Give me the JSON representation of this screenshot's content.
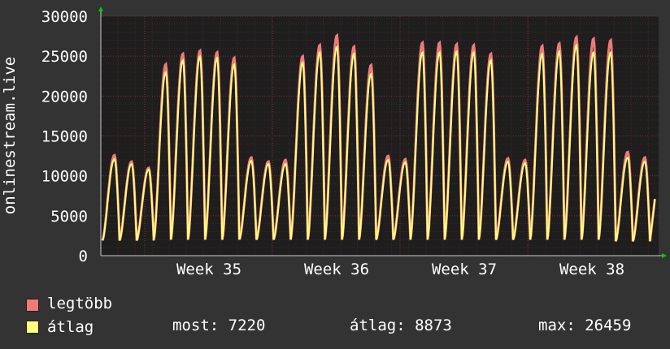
{
  "chart_data": {
    "type": "area",
    "ylabel": "onlinestream.live",
    "ylim": [
      0,
      30000
    ],
    "yticks": [
      0,
      5000,
      10000,
      15000,
      20000,
      25000,
      30000
    ],
    "ytick_labels": [
      "0",
      "5000",
      "10000",
      "15000",
      "20000",
      "25000",
      "30000"
    ],
    "xtick_labels": [
      "Week 35",
      "Week 36",
      "Week 37",
      "Week 38"
    ],
    "grid": true,
    "colors": {
      "background": "#333333",
      "plot": "#1e1e1e",
      "grid": "#6a2a2a",
      "legtobb": "#f07a7a",
      "atlag": "#ffff80",
      "axis_arrow": "#00cc00"
    },
    "days": [
      {
        "day": 1,
        "max": 12600,
        "avg": 12100,
        "min": 1900,
        "gap_after": false
      },
      {
        "day": 2,
        "max": 11800,
        "avg": 11500,
        "min": 1900,
        "gap_after": false
      },
      {
        "day": 3,
        "max": 11000,
        "avg": 10800,
        "min": 1900,
        "gap_after": false
      },
      {
        "day": 4,
        "max": 24000,
        "avg": 23000,
        "min": 2000,
        "gap_after": false
      },
      {
        "day": 5,
        "max": 25300,
        "avg": 24500,
        "min": 2000,
        "gap_after": false
      },
      {
        "day": 6,
        "max": 25700,
        "avg": 25000,
        "min": 2000,
        "gap_after": false
      },
      {
        "day": 7,
        "max": 25500,
        "avg": 24800,
        "min": 2000,
        "gap_after": false
      },
      {
        "day": 8,
        "max": 24800,
        "avg": 24000,
        "min": 2000,
        "gap_after": true
      },
      {
        "day": 9,
        "max": 12300,
        "avg": 11900,
        "min": 2000,
        "gap_after": false
      },
      {
        "day": 10,
        "max": 11800,
        "avg": 11500,
        "min": 2000,
        "gap_after": false
      },
      {
        "day": 11,
        "max": 12000,
        "avg": 11500,
        "min": 2000,
        "gap_after": false
      },
      {
        "day": 12,
        "max": 25000,
        "avg": 24200,
        "min": 2000,
        "gap_after": false
      },
      {
        "day": 13,
        "max": 26400,
        "avg": 25500,
        "min": 2000,
        "gap_after": false
      },
      {
        "day": 14,
        "max": 27600,
        "avg": 26200,
        "min": 2000,
        "gap_after": false
      },
      {
        "day": 15,
        "max": 26200,
        "avg": 25300,
        "min": 2000,
        "gap_after": false
      },
      {
        "day": 16,
        "max": 23900,
        "avg": 22800,
        "min": 2000,
        "gap_after": false
      },
      {
        "day": 17,
        "max": 12500,
        "avg": 12000,
        "min": 2000,
        "gap_after": false
      },
      {
        "day": 18,
        "max": 12100,
        "avg": 11700,
        "min": 2000,
        "gap_after": false
      },
      {
        "day": 19,
        "max": 26700,
        "avg": 25500,
        "min": 2000,
        "gap_after": false
      },
      {
        "day": 20,
        "max": 26700,
        "avg": 25500,
        "min": 2000,
        "gap_after": false
      },
      {
        "day": 21,
        "max": 26500,
        "avg": 25600,
        "min": 2000,
        "gap_after": false
      },
      {
        "day": 22,
        "max": 26400,
        "avg": 25500,
        "min": 2000,
        "gap_after": false
      },
      {
        "day": 23,
        "max": 25300,
        "avg": 24500,
        "min": 2000,
        "gap_after": false
      },
      {
        "day": 24,
        "max": 12200,
        "avg": 11800,
        "min": 2000,
        "gap_after": false
      },
      {
        "day": 25,
        "max": 12000,
        "avg": 11600,
        "min": 2000,
        "gap_after": false
      },
      {
        "day": 26,
        "max": 26300,
        "avg": 25300,
        "min": 2000,
        "gap_after": false
      },
      {
        "day": 27,
        "max": 26600,
        "avg": 25600,
        "min": 2000,
        "gap_after": false
      },
      {
        "day": 28,
        "max": 27400,
        "avg": 26400,
        "min": 2000,
        "gap_after": false
      },
      {
        "day": 29,
        "max": 27200,
        "avg": 25500,
        "min": 2000,
        "gap_after": false
      },
      {
        "day": 30,
        "max": 27000,
        "avg": 25500,
        "min": 2000,
        "gap_after": false
      },
      {
        "day": 31,
        "max": 13000,
        "avg": 12300,
        "min": 1800,
        "gap_after": false
      },
      {
        "day": 32,
        "max": 12300,
        "avg": 11800,
        "min": 1800,
        "gap_after": false
      }
    ],
    "last_value": 7100
  },
  "legend": {
    "max_label": "legtöbb",
    "avg_label": "átlag",
    "now_text": "most: 7220",
    "avg_text": "átlag: 8873",
    "max_text": "max: 26459"
  }
}
